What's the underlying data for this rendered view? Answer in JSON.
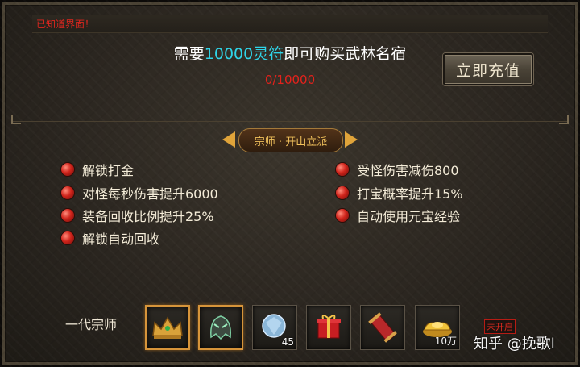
{
  "top_notice": "已知道界面！",
  "header": {
    "need_prefix": "需要",
    "need_amount": "10000",
    "need_currency": "灵符",
    "need_suffix": "即可购买武林名宿",
    "progress_text": "0/10000",
    "recharge_label": "立即充值"
  },
  "section": {
    "title": "宗师 · 开山立派"
  },
  "benefits_left": [
    {
      "label": "解锁打金"
    },
    {
      "label": "对怪每秒伤害提升6000"
    },
    {
      "label": "装备回收比例提升25%"
    },
    {
      "label": "解锁自动回收"
    }
  ],
  "benefits_right": [
    {
      "label": "受怪伤害减伤800"
    },
    {
      "label": "打宝概率提升15%"
    },
    {
      "label": "自动使用元宝经验"
    }
  ],
  "rewards": {
    "lineage_label": "一代宗师",
    "items": [
      {
        "icon": "golden-crown-icon",
        "count": "",
        "selected": true
      },
      {
        "icon": "green-helmet-icon",
        "count": "",
        "selected": true
      },
      {
        "icon": "diamond-gem-icon",
        "count": "45",
        "selected": false
      },
      {
        "icon": "red-gift-box-icon",
        "count": "",
        "selected": false
      },
      {
        "icon": "red-scroll-icon",
        "count": "",
        "selected": false
      },
      {
        "icon": "gold-ingot-icon",
        "count": "10万",
        "selected": false
      }
    ],
    "locked_label": "未开启"
  },
  "watermark": "知乎 @挽歌l",
  "colors": {
    "highlight_cyan": "#2fd4e8",
    "progress_red": "#e3221c",
    "title_gold": "#f2c25c",
    "selected_border": "#d6943a"
  }
}
